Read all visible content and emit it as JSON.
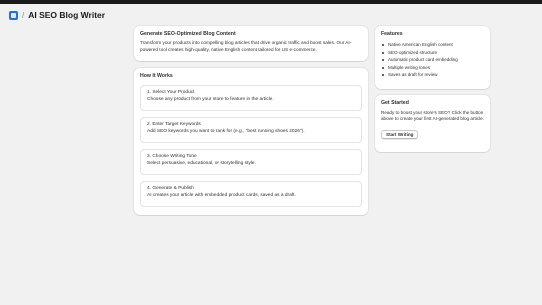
{
  "header": {
    "separator": "/",
    "title": "AI SEO Blog Writer"
  },
  "intro": {
    "heading": "Generate SEO-Optimized Blog Content",
    "text": "Transform your products into compelling blog articles that drive organic traffic and boost sales. Our AI-powered tool creates high-quality, native English content tailored for US e-commerce."
  },
  "how_it_works": {
    "heading": "How It Works",
    "steps": [
      {
        "title": "1. Select Your Product",
        "desc": "Choose any product from your store to feature in the article."
      },
      {
        "title": "2. Enter Target Keywords",
        "desc": "Add SEO keywords you want to rank for (e.g., \"best running shoes 2026\")."
      },
      {
        "title": "3. Choose Writing Tone",
        "desc": "Select persuasive, educational, or storytelling style."
      },
      {
        "title": "4. Generate & Publish",
        "desc": "AI creates your article with embedded product cards, saved as a draft."
      }
    ]
  },
  "features": {
    "heading": "Features",
    "items": [
      "Native American English content",
      "SEO-optimized structure",
      "Automatic product card embedding",
      "Multiple writing tones",
      "Saves as draft for review"
    ]
  },
  "get_started": {
    "heading": "Get Started",
    "text": "Ready to boost your store's SEO? Click the button above to create your first AI-generated blog article.",
    "button_label": "Start Writing"
  },
  "colors": {
    "page_background": "#f1f1f1",
    "topbar": "#1a1a1a",
    "app_icon": "#2c6ecb"
  }
}
